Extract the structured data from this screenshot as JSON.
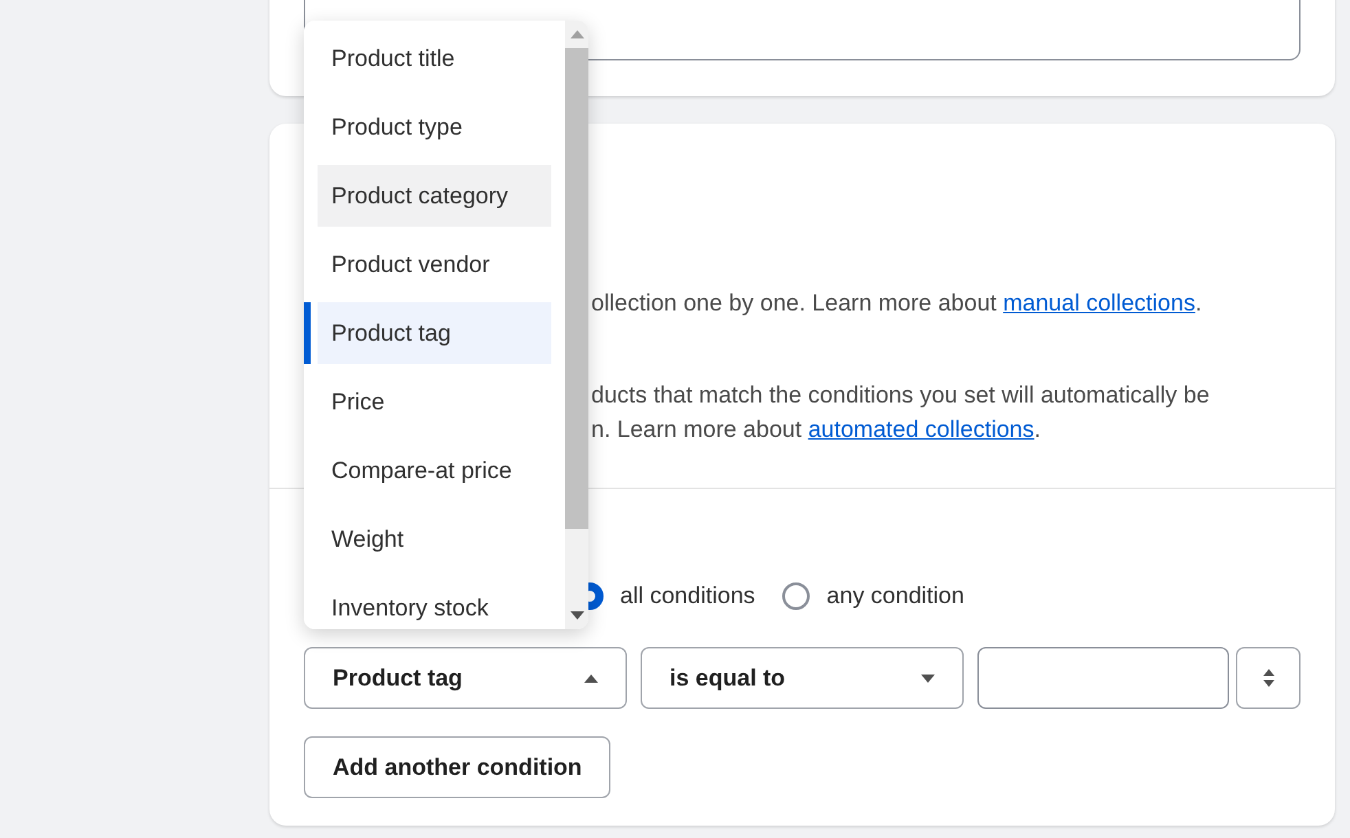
{
  "description": {
    "paragraphs": [
      {
        "lines": [
          {
            "text": "ollection one by one. Learn more about ",
            "link": "manual collections",
            "tail": "."
          }
        ]
      },
      {
        "lines": [
          {
            "text": "ducts that match the conditions you set will automatically be"
          },
          {
            "text": "n. Learn more about ",
            "link": "automated collections",
            "tail": "."
          }
        ]
      }
    ]
  },
  "conditions": {
    "match_options": [
      {
        "label": "all conditions",
        "selected": true
      },
      {
        "label": "any condition",
        "selected": false
      }
    ],
    "rule": {
      "field": "Product tag",
      "field_open": true,
      "operator": "is equal to"
    },
    "add_button": "Add another condition"
  },
  "dropdown": {
    "options": [
      {
        "label": "Product title",
        "selected": false,
        "hovered": false
      },
      {
        "label": "Product type",
        "selected": false,
        "hovered": false
      },
      {
        "label": "Product category",
        "selected": false,
        "hovered": true
      },
      {
        "label": "Product vendor",
        "selected": false,
        "hovered": false
      },
      {
        "label": "Product tag",
        "selected": true,
        "hovered": false
      },
      {
        "label": "Price",
        "selected": false,
        "hovered": false
      },
      {
        "label": "Compare-at price",
        "selected": false,
        "hovered": false
      },
      {
        "label": "Weight",
        "selected": false,
        "hovered": false
      },
      {
        "label": "Inventory stock",
        "selected": false,
        "hovered": false
      }
    ]
  }
}
